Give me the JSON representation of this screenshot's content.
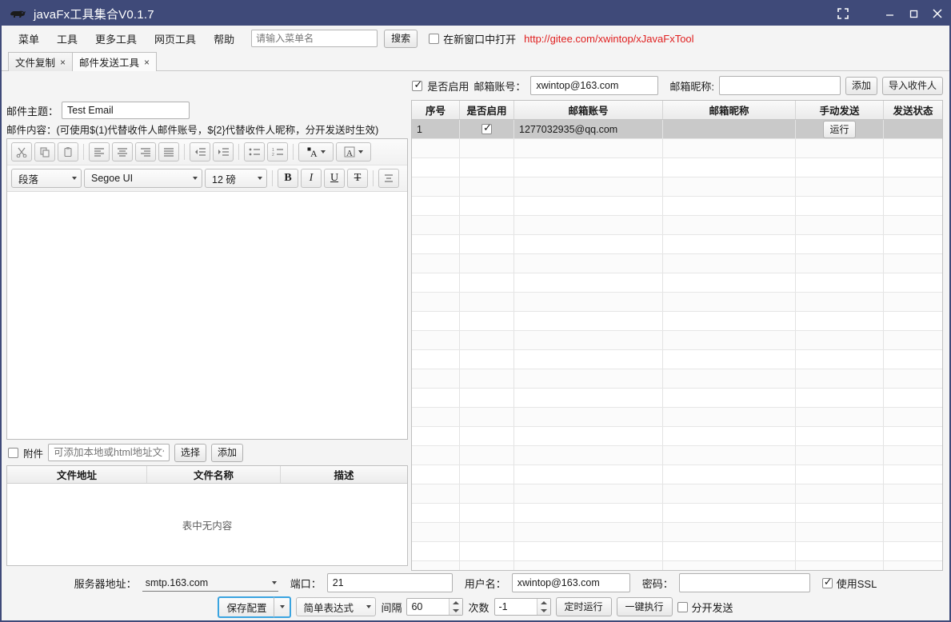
{
  "window": {
    "title": "javaFx工具集合V0.1.7",
    "icon": "boar-icon",
    "controls": {
      "fullscreen": "fullscreen-icon",
      "minimize": "minimize-icon",
      "maximize": "maximize-icon",
      "close": "close-icon"
    },
    "titlebar_color": "#3f4a79"
  },
  "menubar": {
    "items": [
      "菜单",
      "工具",
      "更多工具",
      "网页工具",
      "帮助"
    ],
    "search_placeholder": "请输入菜单名",
    "search_value": "",
    "search_button": "搜索",
    "new_window_label": "在新窗口中打开",
    "new_window_checked": false,
    "url": "http://gitee.com/xwintop/xJavaFxTool",
    "url_color": "#e02020"
  },
  "tabs": [
    {
      "label": "文件复制",
      "close": "×",
      "active": false
    },
    {
      "label": "邮件发送工具",
      "close": "×",
      "active": true
    }
  ],
  "account_row": {
    "enable_label": "是否启用",
    "enable_checked": true,
    "account_label": "邮箱账号：",
    "account_value": "xwintop@163.com",
    "nick_label": "邮箱昵称:",
    "nick_value": "",
    "add_button": "添加",
    "import_button": "导入收件人"
  },
  "mail": {
    "subject_label": "邮件主题：",
    "subject_value": "Test Email",
    "content_label": "邮件内容：",
    "content_hint": "(可使用$(1)代替收件人邮件账号，${2}代替收件人昵称，分开发送时生效)",
    "body_value": ""
  },
  "editor_toolbar": {
    "row1": [
      {
        "name": "cut-icon",
        "glyph": "✂"
      },
      {
        "name": "copy-icon",
        "glyph": "⎘"
      },
      {
        "name": "paste-icon",
        "glyph": "📋"
      },
      {
        "name": "align-left-icon",
        "glyph": "≡"
      },
      {
        "name": "align-center-icon",
        "glyph": "≡"
      },
      {
        "name": "align-right-icon",
        "glyph": "≡"
      },
      {
        "name": "align-justify-icon",
        "glyph": "≡"
      },
      {
        "name": "outdent-icon",
        "glyph": "⇤"
      },
      {
        "name": "indent-icon",
        "glyph": "⇥"
      },
      {
        "name": "bullet-list-icon",
        "glyph": "☰"
      },
      {
        "name": "numbered-list-icon",
        "glyph": "☰"
      },
      {
        "name": "text-color-icon",
        "glyph": "A"
      },
      {
        "name": "highlight-color-icon",
        "glyph": "A"
      }
    ],
    "row2": {
      "paragraph_style": "段落",
      "font_family": "Segoe UI",
      "font_size": "12 磅",
      "bold": "B",
      "italic": "I",
      "underline": "U",
      "strikethrough": "T",
      "align": "align-icon"
    }
  },
  "attachment": {
    "checkbox_label": "附件",
    "checked": false,
    "path_placeholder": "可添加本地或html地址文件",
    "path_value": "",
    "select_button": "选择",
    "add_button": "添加",
    "columns": [
      "文件地址",
      "文件名称",
      "描述"
    ],
    "empty_text": "表中无内容",
    "rows": []
  },
  "recipients_table": {
    "columns": [
      "序号",
      "是否启用",
      "邮箱账号",
      "邮箱昵称",
      "手动发送",
      "发送状态"
    ],
    "rows": [
      {
        "index": "1",
        "enabled": true,
        "account": "1277032935@qq.com",
        "nick": "",
        "send_button": "运行",
        "status": "",
        "selected": true
      }
    ],
    "empty_row_count": 23
  },
  "server": {
    "host_label": "服务器地址：",
    "host_value": "smtp.163.com",
    "port_label": "端口：",
    "port_value": "21",
    "user_label": "用户名：",
    "user_value": "xwintop@163.com",
    "password_label": "密码：",
    "password_value": "",
    "ssl_label": "使用SSL",
    "ssl_checked": true
  },
  "actions": {
    "save_config": "保存配置",
    "expression_mode": "简单表达式",
    "interval_label": "间隔",
    "interval_value": "60",
    "times_label": "次数",
    "times_value": "-1",
    "schedule_run": "定时运行",
    "run_once": "一键执行",
    "separate_send_label": "分开发送",
    "separate_send_checked": false,
    "accent_color": "#3aa4e0"
  }
}
